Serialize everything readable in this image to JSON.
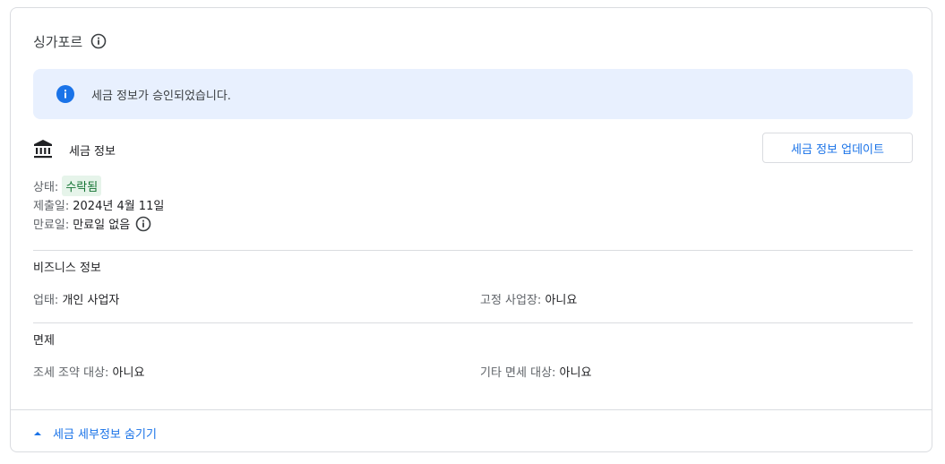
{
  "header": {
    "title": "싱가포르"
  },
  "banner": {
    "message": "세금 정보가 승인되었습니다."
  },
  "tax_info": {
    "heading": "세금 정보",
    "update_button": "세금 정보 업데이트",
    "status_label": "상태:",
    "status_value": "수락됨",
    "submitted_label": "제출일:",
    "submitted_value": "2024년 4월 11일",
    "expiry_label": "만료일:",
    "expiry_value": "만료일 없음"
  },
  "business_info": {
    "heading": "비즈니스 정보",
    "business_type_label": "업태:",
    "business_type_value": "개인 사업자",
    "fixed_place_label": "고정 사업장:",
    "fixed_place_value": "아니요"
  },
  "exemption": {
    "heading": "면제",
    "treaty_label": "조세 조약 대상:",
    "treaty_value": "아니요",
    "other_label": "기타 면세 대상:",
    "other_value": "아니요"
  },
  "footer": {
    "toggle_label": "세금 세부정보 숨기기"
  },
  "colors": {
    "accent": "#1a73e8",
    "banner_bg": "#e8f0fe",
    "status_bg": "#e6f4ea",
    "status_text": "#137333"
  },
  "icons": [
    "info-outline-icon",
    "info-filled-icon",
    "bank-icon",
    "caret-up-icon"
  ]
}
